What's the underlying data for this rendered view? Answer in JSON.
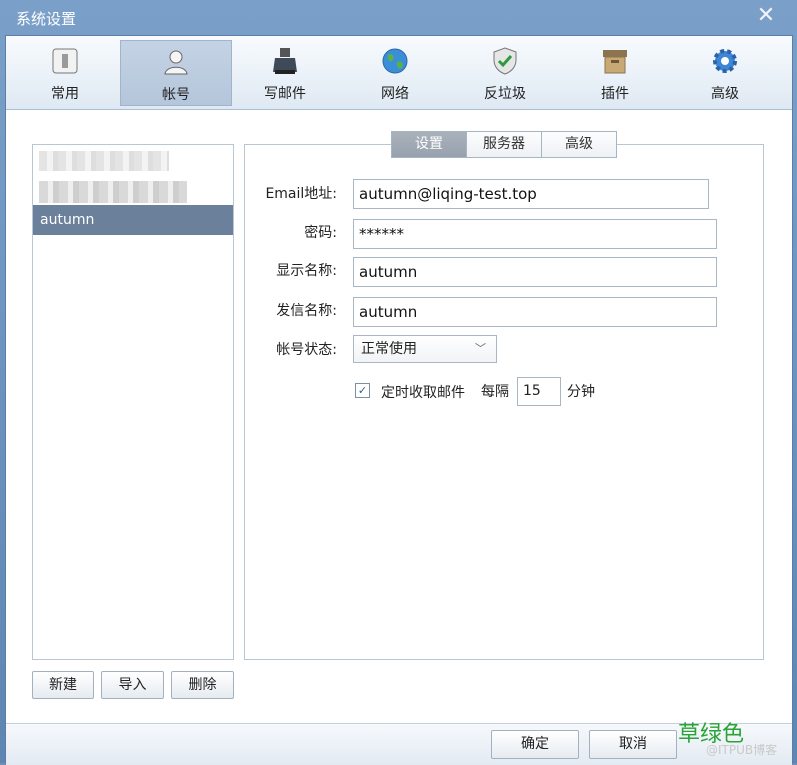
{
  "window": {
    "title": "系统设置"
  },
  "toolbar": {
    "items": [
      {
        "label": "常用",
        "icon": "switch-icon"
      },
      {
        "label": "帐号",
        "icon": "user-icon"
      },
      {
        "label": "写邮件",
        "icon": "inkwell-icon"
      },
      {
        "label": "网络",
        "icon": "globe-icon"
      },
      {
        "label": "反垃圾",
        "icon": "shield-icon"
      },
      {
        "label": "插件",
        "icon": "box-icon"
      },
      {
        "label": "高级",
        "icon": "gear-icon"
      }
    ],
    "active": "帐号"
  },
  "accounts": {
    "selected": "autumn"
  },
  "account_buttons": {
    "new": "新建",
    "import": "导入",
    "delete": "删除"
  },
  "tabs": [
    {
      "label": "设置",
      "active": true
    },
    {
      "label": "服务器",
      "active": false
    },
    {
      "label": "高级",
      "active": false
    }
  ],
  "form": {
    "email_label": "Email地址:",
    "email_value": "autumn@liqing-test.top",
    "password_label": "密码:",
    "password_value": "******",
    "display_label": "显示名称:",
    "display_value": "autumn",
    "sender_label": "发信名称:",
    "sender_value": "autumn",
    "status_label": "帐号状态:",
    "status_value": "正常使用",
    "auto_fetch_label": "定时收取邮件",
    "auto_fetch_checked": true,
    "every_label": "每隔",
    "interval_value": "15",
    "minutes_label": "分钟"
  },
  "footer": {
    "ok": "确定",
    "cancel": "取消"
  },
  "watermark": {
    "text": "草绿色",
    "sub": "@ITPUB博客"
  },
  "colors": {
    "selection": "#6b809b",
    "accent_green": "#2aa336"
  }
}
